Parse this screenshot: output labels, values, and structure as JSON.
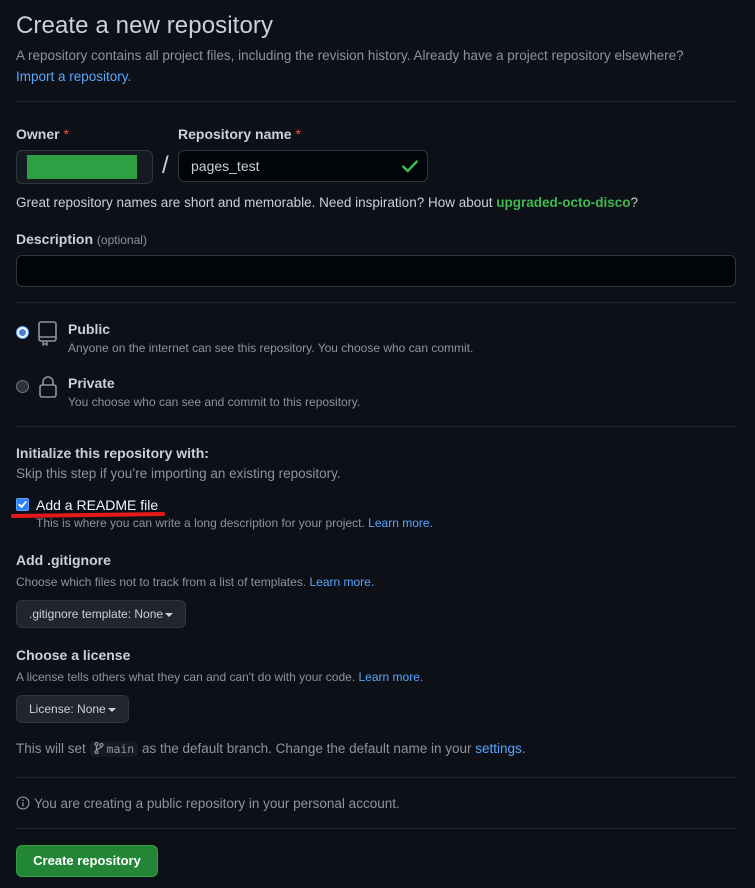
{
  "header": {
    "title": "Create a new repository",
    "subtitle": "A repository contains all project files, including the revision history. Already have a project repository elsewhere?",
    "import_link": "Import a repository."
  },
  "owner": {
    "label": "Owner",
    "required_mark": "*"
  },
  "repo_name": {
    "label": "Repository name",
    "required_mark": "*",
    "value": "pages_test",
    "separator": "/"
  },
  "name_hint": {
    "text": "Great repository names are short and memorable. Need inspiration? How about",
    "suggestion": "upgraded-octo-disco",
    "suffix": "?"
  },
  "description": {
    "label": "Description",
    "optional": "(optional)",
    "value": ""
  },
  "visibility": {
    "public": {
      "title": "Public",
      "desc": "Anyone on the internet can see this repository. You choose who can commit.",
      "selected": true
    },
    "private": {
      "title": "Private",
      "desc": "You choose who can see and commit to this repository.",
      "selected": false
    }
  },
  "init": {
    "title": "Initialize this repository with:",
    "subtitle": "Skip this step if you’re importing an existing repository.",
    "readme_label": "Add a README file",
    "readme_checked": true,
    "readme_desc": "This is where you can write a long description for your project.",
    "learn_more": "Learn more."
  },
  "gitignore": {
    "title": "Add .gitignore",
    "desc": "Choose which files not to track from a list of templates.",
    "learn_more": "Learn more.",
    "select": ".gitignore template: None"
  },
  "license": {
    "title": "Choose a license",
    "desc": "A license tells others what they can and can't do with your code.",
    "learn_more": "Learn more.",
    "select": "License: None"
  },
  "branch": {
    "prefix": "This will set",
    "name": "main",
    "middle": "as the default branch. Change the default name in your",
    "settings_link": "settings",
    "suffix": "."
  },
  "info": {
    "text": "You are creating a public repository in your personal account."
  },
  "submit": {
    "label": "Create repository"
  },
  "colors": {
    "background": "#0d1117",
    "accent": "#58a6ff",
    "primary_button": "#238636",
    "suggestion": "#3fb950",
    "annotation_underline": "#e5191c"
  }
}
